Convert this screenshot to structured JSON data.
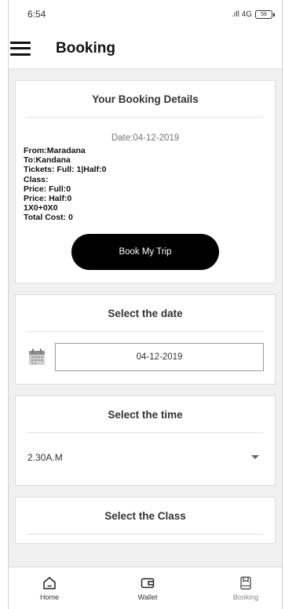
{
  "status_bar": {
    "time": "6:54",
    "signal": ".ıll 4G",
    "battery": "58"
  },
  "appbar": {
    "title": "Booking"
  },
  "booking_card": {
    "title": "Your Booking Details",
    "date_line": "Date:04-12-2019",
    "details": [
      "From:Maradana",
      "To:Kandana",
      "Tickets: Full: 1|Half:0",
      "Class:",
      "Price: Full:0",
      "Price: Half:0",
      "1X0+0X0",
      "Total Cost: 0"
    ],
    "button_label": "Book My Trip"
  },
  "date_card": {
    "title": "Select the date",
    "value": "04-12-2019",
    "icon": "calendar-icon"
  },
  "time_card": {
    "title": "Select the time",
    "value": "2.30A.M",
    "icon": "dropdown-arrow-icon"
  },
  "class_card": {
    "title": "Select the Class"
  },
  "bottom_nav": {
    "items": [
      {
        "label": "Home",
        "icon": "home-icon"
      },
      {
        "label": "Wallet",
        "icon": "wallet-icon"
      },
      {
        "label": "Booking",
        "icon": "booking-icon",
        "active": true
      }
    ]
  }
}
